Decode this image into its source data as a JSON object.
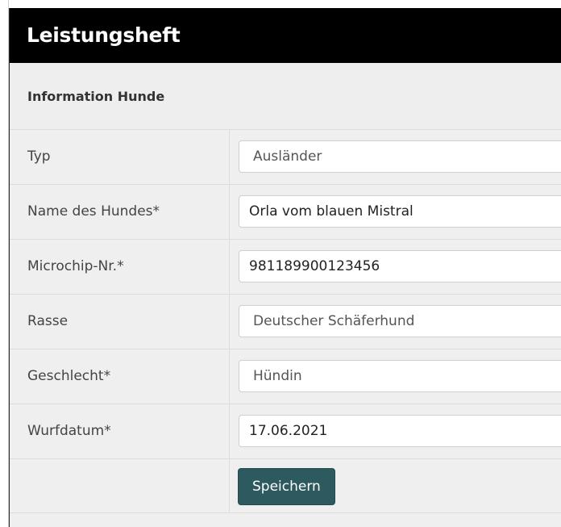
{
  "header": {
    "title": "Leistungsheft"
  },
  "section": {
    "title": "Information Hunde"
  },
  "form": {
    "fields": [
      {
        "label": "Typ",
        "value": "Ausländer",
        "kind": "select"
      },
      {
        "label": "Name des Hundes*",
        "value": "Orla vom blauen Mistral",
        "kind": "text"
      },
      {
        "label": "Microchip-Nr.*",
        "value": "981189900123456",
        "kind": "text"
      },
      {
        "label": "Rasse",
        "value": "Deutscher Schäferhund",
        "kind": "select"
      },
      {
        "label": "Geschlecht*",
        "value": "Hündin",
        "kind": "select"
      },
      {
        "label": "Wurfdatum*",
        "value": "17.06.2021",
        "kind": "text"
      }
    ],
    "save_label": "Speichern"
  },
  "colors": {
    "header_bg": "#000000",
    "button_bg": "#2d5a5e",
    "panel_bg": "#efefef"
  }
}
